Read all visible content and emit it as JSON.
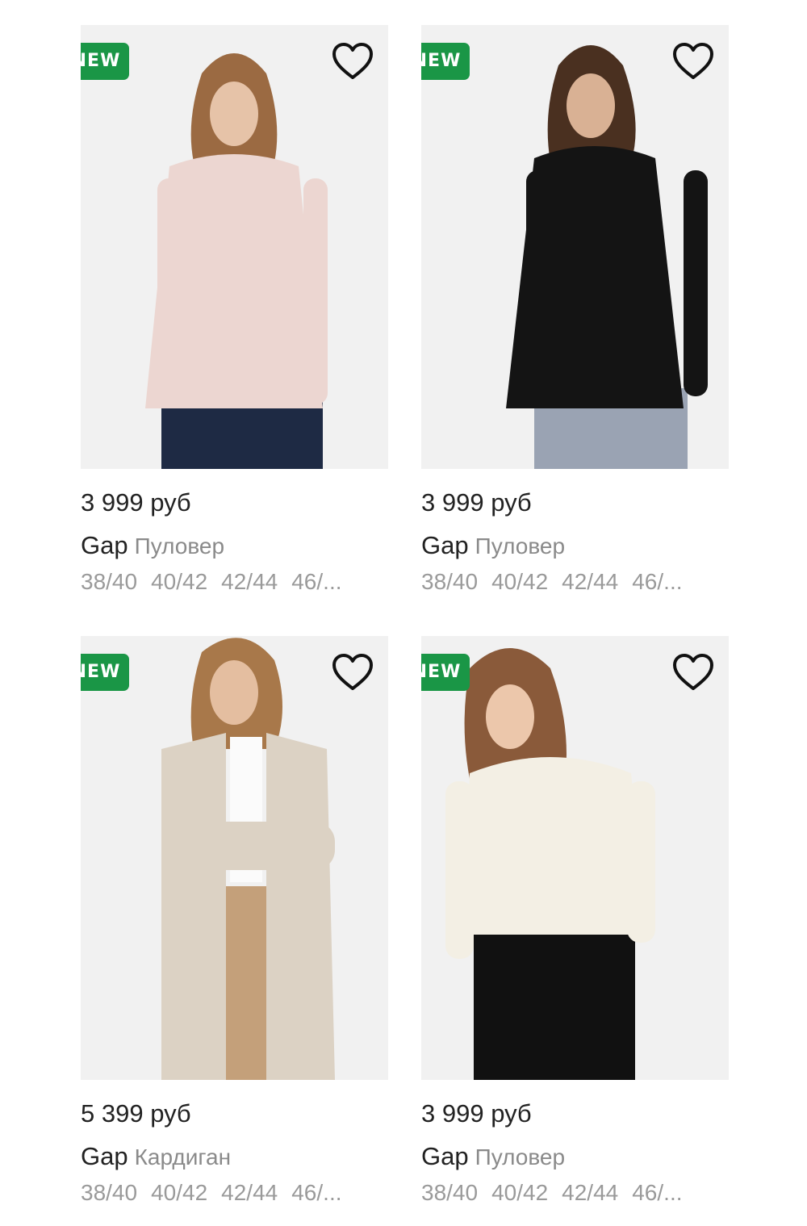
{
  "colors": {
    "badge_bg": "#1a9646",
    "price_text": "#222222",
    "muted_text": "#8a8a8a"
  },
  "products": [
    {
      "badge": "NEW",
      "favorite_icon": "heart-outline-icon",
      "price": "3 999 руб",
      "brand": "Gap",
      "type": "Пуловер",
      "sizes": [
        "38/40",
        "40/42",
        "42/44",
        "46/..."
      ],
      "garment_color": "#ecd6d1",
      "bottoms_color": "#1e2a44"
    },
    {
      "badge": "NEW",
      "favorite_icon": "heart-outline-icon",
      "price": "3 999 руб",
      "brand": "Gap",
      "type": "Пуловер",
      "sizes": [
        "38/40",
        "40/42",
        "42/44",
        "46/..."
      ],
      "garment_color": "#141414",
      "bottoms_color": "#9aa3b3"
    },
    {
      "badge": "NEW",
      "favorite_icon": "heart-outline-icon",
      "price": "5 399 руб",
      "brand": "Gap",
      "type": "Кардиган",
      "sizes": [
        "38/40",
        "40/42",
        "42/44",
        "46/..."
      ],
      "garment_color": "#dcd2c4",
      "bottoms_color": "#c4a07a"
    },
    {
      "badge": "NEW",
      "favorite_icon": "heart-outline-icon",
      "price": "3 999 руб",
      "brand": "Gap",
      "type": "Пуловер",
      "sizes": [
        "38/40",
        "40/42",
        "42/44",
        "46/..."
      ],
      "garment_color": "#f3efe4",
      "bottoms_color": "#111111"
    }
  ]
}
